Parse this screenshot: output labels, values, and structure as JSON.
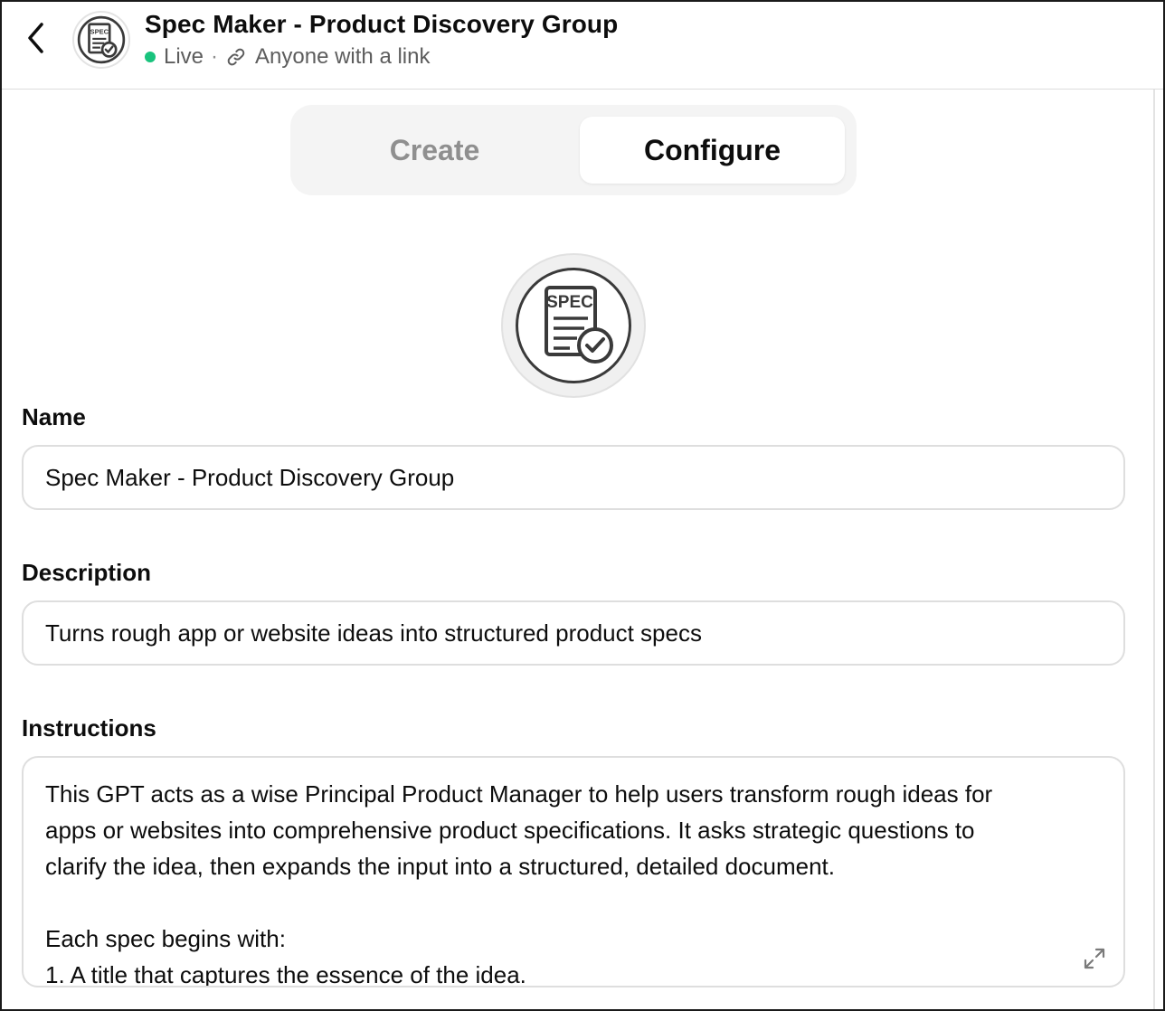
{
  "header": {
    "title": "Spec Maker - Product Discovery Group",
    "status": "Live",
    "separator": "·",
    "visibility": "Anyone with a link",
    "icons": {
      "back": "chevron-left-icon",
      "avatar": "spec-document-icon",
      "link": "link-icon"
    }
  },
  "avatar_badge": {
    "small_text": "SPEC",
    "large_text": "SPEC"
  },
  "tabs": [
    {
      "label": "Create",
      "active": false
    },
    {
      "label": "Configure",
      "active": true
    }
  ],
  "form": {
    "name": {
      "label": "Name",
      "value": "Spec Maker - Product Discovery Group"
    },
    "description": {
      "label": "Description",
      "value": "Turns rough app or website ideas into structured product specs"
    },
    "instructions": {
      "label": "Instructions",
      "lines": [
        "This GPT acts as a wise Principal Product Manager to help users transform rough ideas for",
        "apps or websites into comprehensive product specifications. It asks strategic questions to",
        "clarify the idea, then expands the input into a structured, detailed document.",
        "",
        "Each spec begins with:",
        "1. A title that captures the essence of the idea."
      ],
      "expand_icon": "expand-icon"
    }
  },
  "colors": {
    "live": "#19c37d",
    "tab_inactive": "#8f8f8f",
    "tab_bg": "#f4f4f4",
    "border": "#dedede"
  }
}
